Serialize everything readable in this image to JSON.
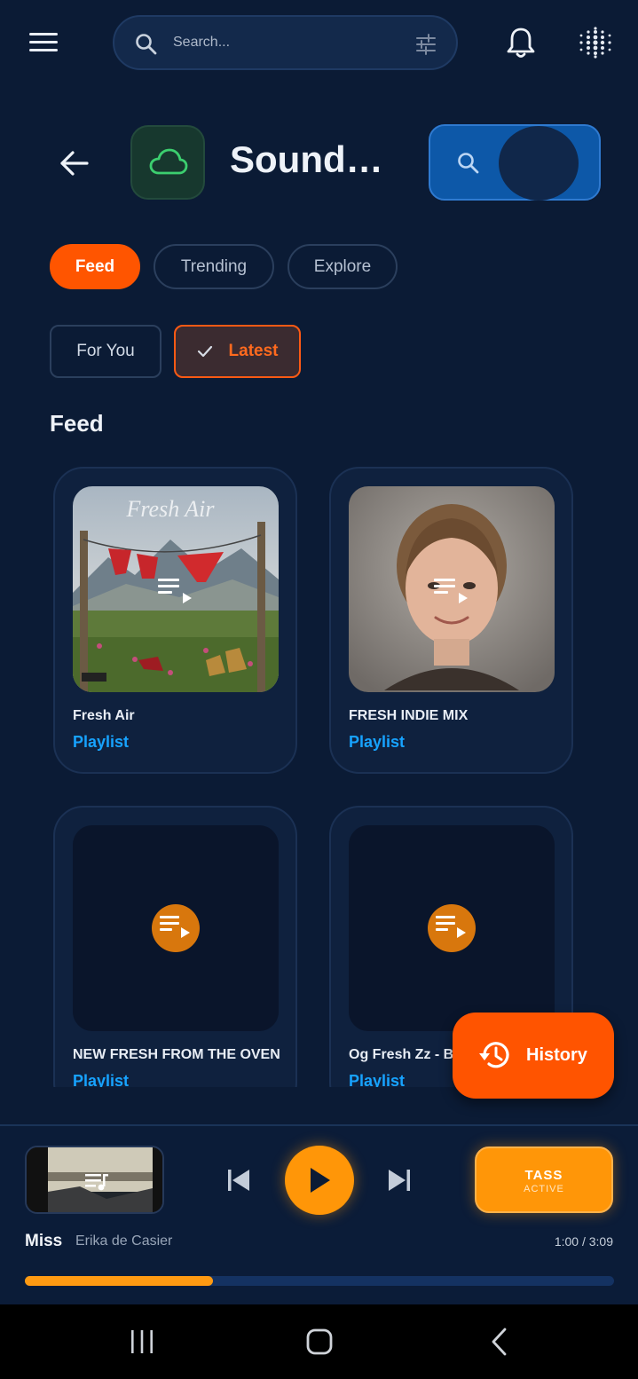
{
  "search": {
    "placeholder": "Search..."
  },
  "header": {
    "title": "SoundCloud"
  },
  "tabs": [
    {
      "label": "Feed",
      "active": true
    },
    {
      "label": "Trending",
      "active": false
    },
    {
      "label": "Explore",
      "active": false
    }
  ],
  "filters": [
    {
      "label": "For You",
      "selected": false
    },
    {
      "label": "Latest",
      "selected": true
    }
  ],
  "section": {
    "title": "Feed"
  },
  "cards": [
    {
      "title": "Fresh Air",
      "type": "Playlist",
      "art": "Fresh Air"
    },
    {
      "title": "FRESH INDIE MIX",
      "type": "Playlist"
    },
    {
      "title": "NEW FRESH FROM THE OVEN",
      "type": "Playlist"
    },
    {
      "title": "Og Fresh Zz - B",
      "type": "Playlist"
    }
  ],
  "fab": {
    "label": "History"
  },
  "player": {
    "title": "Miss",
    "artist": "Erika de Casier",
    "time": "1:00 / 3:09",
    "progress": 0.32,
    "mode_label": "TASS",
    "mode_status": "ACTIVE"
  },
  "colors": {
    "background": "#0b1b35",
    "accent": "#ff5500",
    "player_accent": "#ff9608",
    "link": "#17a3ff"
  }
}
